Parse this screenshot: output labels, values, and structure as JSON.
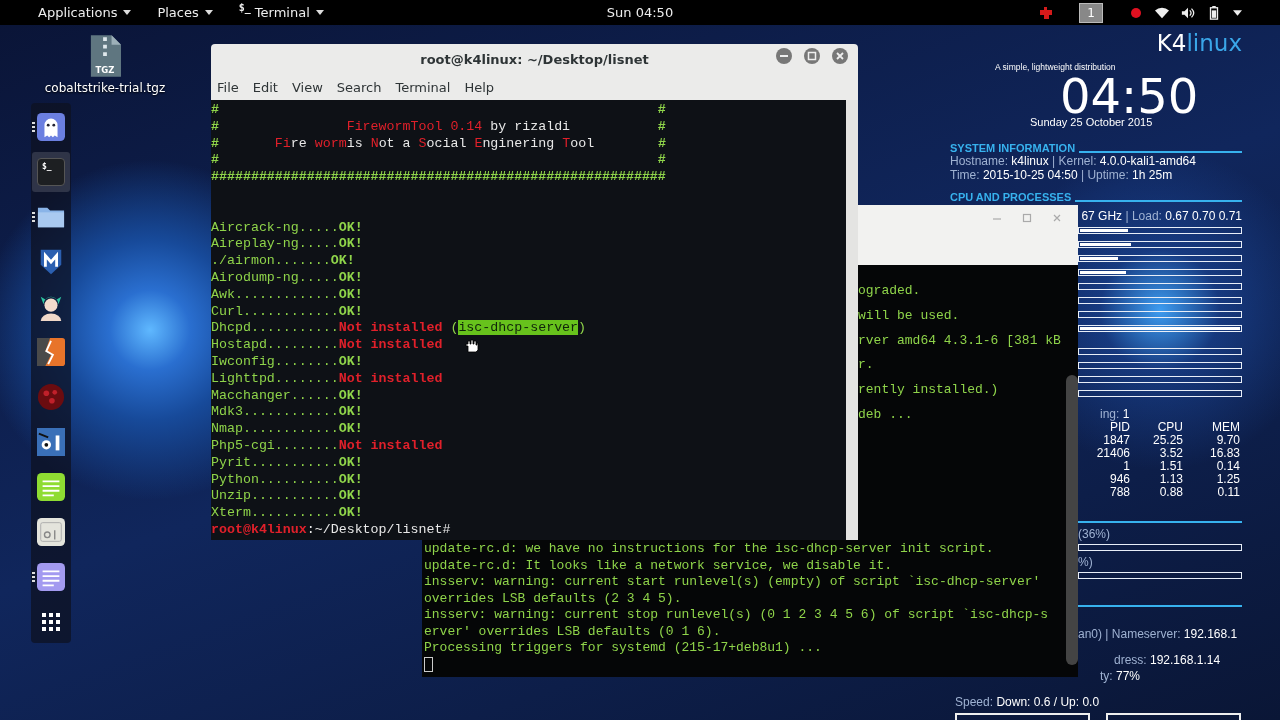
{
  "topbar": {
    "menus": [
      {
        "label": "Applications"
      },
      {
        "label": "Places"
      }
    ],
    "app_menu": {
      "glyph": "$_",
      "label": "Terminal"
    },
    "clock": "Sun 04:50",
    "workspace": "1"
  },
  "desktop_file": {
    "badge": "TGZ",
    "name": "cobaltstrike-trial.tgz"
  },
  "dock": {
    "items": [
      {
        "kind": "ghost",
        "running": true,
        "selected": false
      },
      {
        "kind": "terminal",
        "glyph": "$_",
        "running": false,
        "selected": true
      },
      {
        "kind": "folder",
        "running": true,
        "selected": false
      },
      {
        "kind": "shield",
        "running": false,
        "selected": false
      },
      {
        "kind": "person",
        "running": false,
        "selected": false
      },
      {
        "kind": "bolt",
        "running": false,
        "selected": false
      },
      {
        "kind": "spots",
        "running": false,
        "selected": false
      },
      {
        "kind": "eyes",
        "running": false,
        "selected": false
      },
      {
        "kind": "notes",
        "running": false,
        "selected": false
      },
      {
        "kind": "panel",
        "running": false,
        "selected": false
      },
      {
        "kind": "document",
        "running": true,
        "selected": false
      },
      {
        "kind": "grid",
        "running": false,
        "selected": false
      }
    ]
  },
  "terminal_front": {
    "title": "root@k4linux: ~/Desktop/lisnet",
    "menu": [
      "File",
      "Edit",
      "View",
      "Search",
      "Terminal",
      "Help"
    ],
    "banner": [
      [
        {
          "text": "#                                                       #",
          "kind": "hash"
        }
      ],
      [
        {
          "text": "#                ",
          "kind": "hash"
        },
        {
          "text": "FirewormTool 0.14",
          "kind": "accent"
        },
        {
          "text": " by rizaldi",
          "kind": "white"
        },
        {
          "text": "           #",
          "kind": "hash"
        }
      ],
      [
        {
          "text": "#       ",
          "kind": "hash"
        },
        {
          "text": "Fi",
          "kind": "accent"
        },
        {
          "text": "re ",
          "kind": "white"
        },
        {
          "text": "worm",
          "kind": "accent"
        },
        {
          "text": "is ",
          "kind": "white"
        },
        {
          "text": "N",
          "kind": "accent"
        },
        {
          "text": "ot a ",
          "kind": "white"
        },
        {
          "text": "S",
          "kind": "accent"
        },
        {
          "text": "ocial ",
          "kind": "white"
        },
        {
          "text": "E",
          "kind": "accent"
        },
        {
          "text": "nginering ",
          "kind": "white"
        },
        {
          "text": "T",
          "kind": "accent"
        },
        {
          "text": "ool",
          "kind": "white"
        },
        {
          "text": "        #",
          "kind": "hash"
        }
      ],
      [
        {
          "text": "#                                                       #",
          "kind": "hash"
        }
      ],
      [
        {
          "text": "#########################################################",
          "kind": "hash"
        }
      ]
    ],
    "results": [
      [
        {
          "text": "Aircrack-ng.....",
          "kind": "plain"
        },
        {
          "text": "OK!",
          "kind": "ok"
        }
      ],
      [
        {
          "text": "Aireplay-ng.....",
          "kind": "plain"
        },
        {
          "text": "OK!",
          "kind": "ok"
        }
      ],
      [
        {
          "text": "./airmon.......",
          "kind": "plain"
        },
        {
          "text": "OK!",
          "kind": "ok"
        }
      ],
      [
        {
          "text": "Airodump-ng.....",
          "kind": "plain"
        },
        {
          "text": "OK!",
          "kind": "ok"
        }
      ],
      [
        {
          "text": "Awk.............",
          "kind": "plain"
        },
        {
          "text": "OK!",
          "kind": "ok"
        }
      ],
      [
        {
          "text": "Curl............",
          "kind": "plain"
        },
        {
          "text": "OK!",
          "kind": "ok"
        }
      ],
      [
        {
          "text": "Dhcpd...........",
          "kind": "plain"
        },
        {
          "text": "Not installed",
          "kind": "error"
        },
        {
          "text": " (",
          "kind": "plain"
        },
        {
          "text": "isc-dhcp-server",
          "kind": "selection"
        },
        {
          "text": ")",
          "kind": "plain"
        }
      ],
      [
        {
          "text": "Hostapd.........",
          "kind": "plain"
        },
        {
          "text": "Not installed",
          "kind": "error"
        }
      ],
      [
        {
          "text": "Iwconfig........",
          "kind": "plain"
        },
        {
          "text": "OK!",
          "kind": "ok"
        }
      ],
      [
        {
          "text": "Lighttpd........",
          "kind": "plain"
        },
        {
          "text": "Not installed",
          "kind": "error"
        }
      ],
      [
        {
          "text": "Macchanger......",
          "kind": "plain"
        },
        {
          "text": "OK!",
          "kind": "ok"
        }
      ],
      [
        {
          "text": "Mdk3............",
          "kind": "plain"
        },
        {
          "text": "OK!",
          "kind": "ok"
        }
      ],
      [
        {
          "text": "Nmap............",
          "kind": "plain"
        },
        {
          "text": "OK!",
          "kind": "ok"
        }
      ],
      [
        {
          "text": "Php5-cgi........",
          "kind": "plain"
        },
        {
          "text": "Not installed",
          "kind": "error"
        }
      ],
      [
        {
          "text": "Pyrit...........",
          "kind": "plain"
        },
        {
          "text": "OK!",
          "kind": "ok"
        }
      ],
      [
        {
          "text": "Python..........",
          "kind": "plain"
        },
        {
          "text": "OK!",
          "kind": "ok"
        }
      ],
      [
        {
          "text": "Unzip...........",
          "kind": "plain"
        },
        {
          "text": "OK!",
          "kind": "ok"
        }
      ],
      [
        {
          "text": "Xterm...........",
          "kind": "plain"
        },
        {
          "text": "OK!",
          "kind": "ok"
        }
      ]
    ],
    "prompt": {
      "user": "root@k4linux",
      "path": ":~/Desktop/lisnet#"
    }
  },
  "terminal_back": {
    "fragments": [
      "ograded.",
      "will be used.",
      "rver amd64 4.3.1-6 [381 kB",
      "r.",
      "rently installed.)",
      "deb ..."
    ],
    "lines": [
      "update-rc.d: we have no instructions for the isc-dhcp-server init script.",
      "update-rc.d: It looks like a network service, we disable it.",
      "insserv: warning: current start runlevel(s) (empty) of script `isc-dhcp-server'",
      "overrides LSB defaults (2 3 4 5).",
      "insserv: warning: current stop runlevel(s) (0 1 2 3 4 5 6) of script `isc-dhcp-s",
      "erver' overrides LSB defaults (0 1 6).",
      "Processing triggers for systemd (215-17+deb8u1) ..."
    ]
  },
  "conky": {
    "logo": {
      "prefix": "K4",
      "suffix": "linux"
    },
    "tagline": "A simple, lightweight distribution",
    "clock": "04:50",
    "date": "Sunday 25 October 2015",
    "system": {
      "heading": "SYSTEM INFORMATION",
      "lines": [
        "Hostname: **k4linux**  | Kernel: **4.0.0-kali1-amd64**",
        "Time: **2015-10-25 04:50**  | Uptime: **1h 25m**"
      ]
    },
    "cpu": {
      "heading": "CPU AND PROCESSES",
      "load": "**67 GHz** | Load: **0.67 0.70 0.71**",
      "cpu_bars": [
        {
          "level": 0.3
        },
        {
          "level": 0.32
        },
        {
          "level": 0.24
        },
        {
          "level": 0.29
        },
        {
          "level": 0
        },
        {
          "level": 0
        },
        {
          "level": 0
        },
        {
          "level": 1
        }
      ],
      "core_bars": [
        {
          "level": 0
        },
        {
          "level": 0
        },
        {
          "level": 0
        },
        {
          "level": 0
        }
      ],
      "processes": "ing: **1**",
      "columns": [
        "PID",
        "CPU",
        "MEM"
      ],
      "rows": [
        [
          "1847",
          "25.25",
          "9.70"
        ],
        [
          "21406",
          "3.52",
          "16.83"
        ],
        [
          "1",
          "1.51",
          "0.14"
        ],
        [
          "946",
          "1.13",
          "1.25"
        ],
        [
          "788",
          "0.88",
          "0.11"
        ]
      ]
    },
    "memory": {
      "ram": "(36%)",
      "ram_bar": {
        "level": 0
      },
      "swap": "%)",
      "swap_bar": {
        "level": 0
      }
    },
    "network": {
      "gateway": "an0) | Nameserver: **192.168.1**",
      "address": "dress: **192.168.1.14**",
      "quality": "ty: **77%**",
      "speed": "Speed: **Down: 0.6 / Up: 0.0**"
    }
  }
}
